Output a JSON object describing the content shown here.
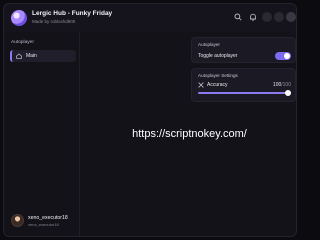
{
  "app": {
    "title": "Lergic Hub - Funky Friday",
    "subtitle": "Made by robloxhd900",
    "accent_color": "#8b7cf6"
  },
  "titlebar": {
    "icons": [
      "search-icon",
      "bell-icon",
      "settings-icon",
      "minimize-icon",
      "close-icon"
    ]
  },
  "sidebar": {
    "section_title": "Autoplayer",
    "items": [
      {
        "label": "Main",
        "icon": "home-icon",
        "active": true
      }
    ]
  },
  "user": {
    "name": "xeno_executor18",
    "handle": "xeno_executor18"
  },
  "autoplayer_card": {
    "title": "Autoplayer",
    "toggle_label": "Toggle autoplayer",
    "toggle_on": true
  },
  "settings_card": {
    "title": "Autoplayer Settings",
    "slider_label": "Accuracy",
    "slider_value": "100",
    "slider_max": "/100",
    "slider_fraction": 1.0
  },
  "watermark": "https://scriptnokey.com/"
}
